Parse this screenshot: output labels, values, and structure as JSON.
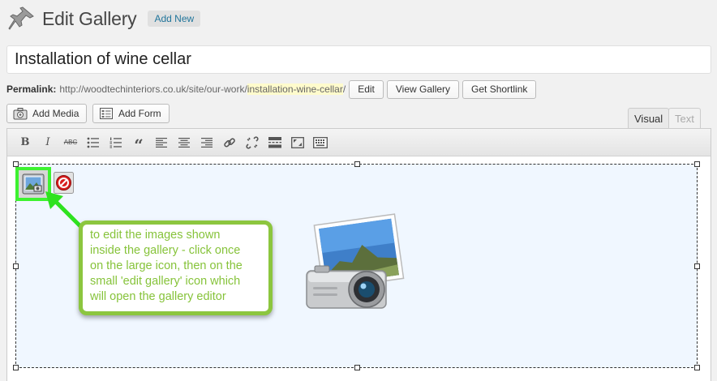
{
  "header": {
    "title": "Edit Gallery",
    "add_new_label": "Add New"
  },
  "post": {
    "title_value": "Installation of wine cellar"
  },
  "permalink": {
    "label": "Permalink:",
    "base_url": "http://woodtechinteriors.co.uk/site/our-work/",
    "slug": "installation-wine-cellar",
    "trailing": "/",
    "edit_label": "Edit",
    "view_label": "View Gallery",
    "shortlink_label": "Get Shortlink"
  },
  "media": {
    "add_media_label": "Add Media",
    "add_form_label": "Add Form"
  },
  "editor_tabs": {
    "visual_label": "Visual",
    "text_label": "Text",
    "active": "Visual"
  },
  "toolbar": {
    "bold_label": "B",
    "italic_label": "I",
    "strike_label": "ABC",
    "quote_label": "“"
  },
  "callout": {
    "lines": [
      "to edit the images shown",
      "inside the gallery - click once",
      "on the large icon, then on the",
      "small 'edit gallery' icon which",
      "will open the gallery editor"
    ]
  },
  "colors": {
    "callout_green": "#8cc63f",
    "highlight_green": "#3df230",
    "link_blue": "#21759b"
  }
}
